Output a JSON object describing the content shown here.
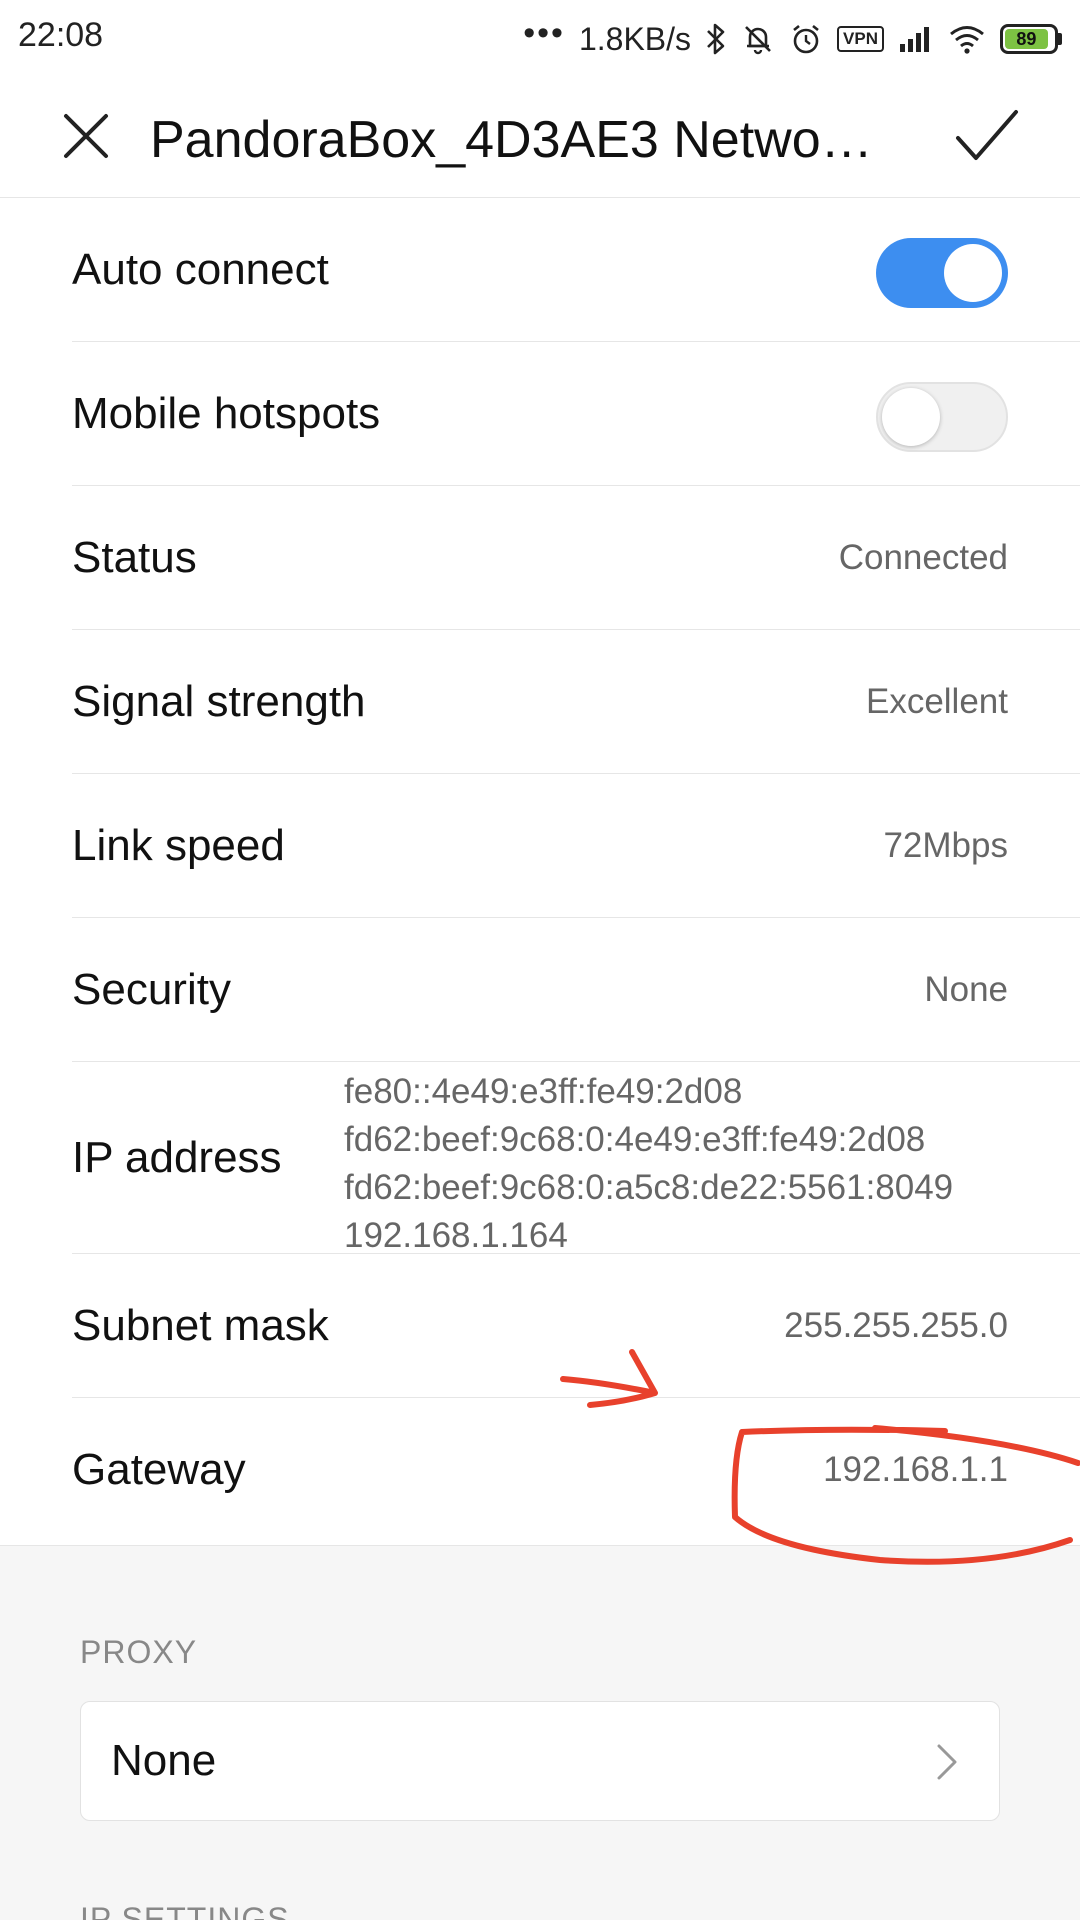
{
  "status_bar": {
    "time": "22:08",
    "dots": "•••",
    "net_speed": "1.8KB/s",
    "vpn_label": "VPN",
    "battery_level": "89",
    "battery_color": "#7dc243"
  },
  "header": {
    "title": "PandoraBox_4D3AE3  Netwo…",
    "close_icon": "close-icon",
    "confirm_icon": "checkmark-icon"
  },
  "rows": {
    "auto_connect": {
      "label": "Auto connect",
      "toggle_on": true
    },
    "mobile_hotspots": {
      "label": "Mobile hotspots",
      "toggle_on": false
    },
    "status": {
      "label": "Status",
      "value": "Connected"
    },
    "signal_strength": {
      "label": "Signal strength",
      "value": "Excellent"
    },
    "link_speed": {
      "label": "Link speed",
      "value": "72Mbps"
    },
    "security": {
      "label": "Security",
      "value": "None"
    },
    "ip_address": {
      "label": "IP address",
      "values": [
        "fe80::4e49:e3ff:fe49:2d08",
        "fd62:beef:9c68:0:4e49:e3ff:fe49:2d08",
        "fd62:beef:9c68:0:a5c8:de22:5561:8049",
        "192.168.1.164"
      ]
    },
    "subnet_mask": {
      "label": "Subnet mask",
      "value": "255.255.255.0"
    },
    "gateway": {
      "label": "Gateway",
      "value": "192.168.1.1"
    }
  },
  "proxy": {
    "section_label": "PROXY",
    "value": "None"
  },
  "ip_settings": {
    "section_label": "IP SETTINGS"
  },
  "colors": {
    "accent": "#3d8ef0",
    "annotation": "#e8412c"
  }
}
